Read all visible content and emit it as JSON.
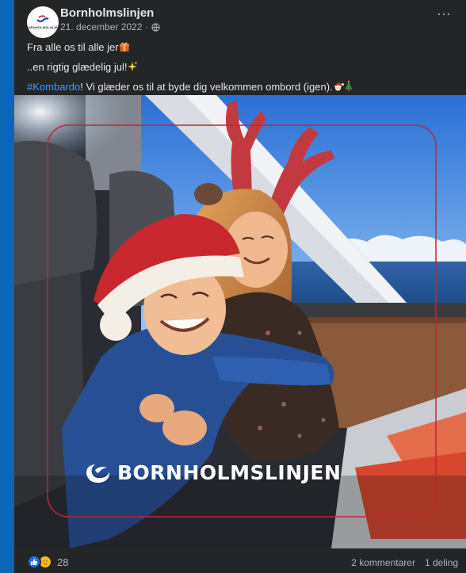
{
  "post": {
    "page_name": "Bornholmslinjen",
    "date": "21. december 2022",
    "separator": "·",
    "avatar_text": "BORNHOLMSLINJEN",
    "more_label": "···",
    "lines": {
      "line1": "Fra alle os til alle jer",
      "line2": "..en rigtig glædelig jul!",
      "line3_hashtag": "#Kombardo",
      "line3_rest": "! Vi glæder os til at byde dig velkommen ombord (igen)."
    },
    "image": {
      "logo_text": "BORNHOLMSLINJEN"
    }
  },
  "footer": {
    "reaction_count": "28",
    "comments": "2 kommentarer",
    "shares": "1 deling"
  },
  "icons": {
    "globe": "globe-icon",
    "gift": "gift-emoji-icon",
    "sparkles": "sparkles-emoji-icon",
    "santa": "santa-emoji-icon",
    "tree": "christmas-tree-emoji-icon",
    "like": "like-icon",
    "care": "care-icon",
    "more": "more-options-icon"
  },
  "colors": {
    "brand_blue": "#0b66b8",
    "hashtag": "#4599ff",
    "frame_red": "#c0243a",
    "card_bg": "#242526"
  }
}
